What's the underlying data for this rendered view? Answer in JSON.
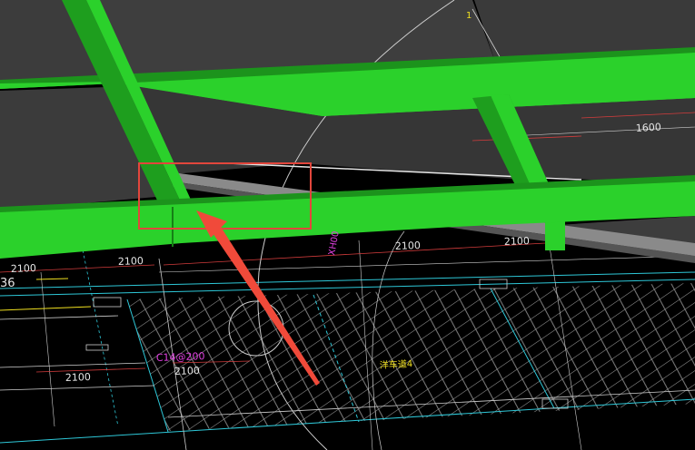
{
  "colors": {
    "background": "#000000",
    "slab_gray": "#3c3c3c",
    "slab_gray_dark": "#333333",
    "beam_green": "#2bd12b",
    "beam_green_dark": "#1c931c",
    "highlight_red": "#e2463c",
    "arrow_red": "#f04a3a",
    "grid_white": "#cfcfcf",
    "grid_cyan": "#2ec8d8",
    "dim_red": "#d23c3c",
    "magenta": "#e040e0",
    "yellow": "#f0e020"
  },
  "drawing": {
    "dimensions": [
      {
        "text": "2100"
      },
      {
        "text": "2100"
      },
      {
        "text": "2100"
      },
      {
        "text": "2100"
      },
      {
        "text": "2100"
      },
      {
        "text": "2100"
      },
      {
        "text": "1600"
      }
    ],
    "axis_mark": "36",
    "rebar_label": "C14@200",
    "car_lane_label": "洋车道4",
    "rotated_label": "XH00",
    "top_mark": "1"
  },
  "annotation": {
    "highlight_box": "red-rectangle",
    "pointer": "red-arrow"
  }
}
